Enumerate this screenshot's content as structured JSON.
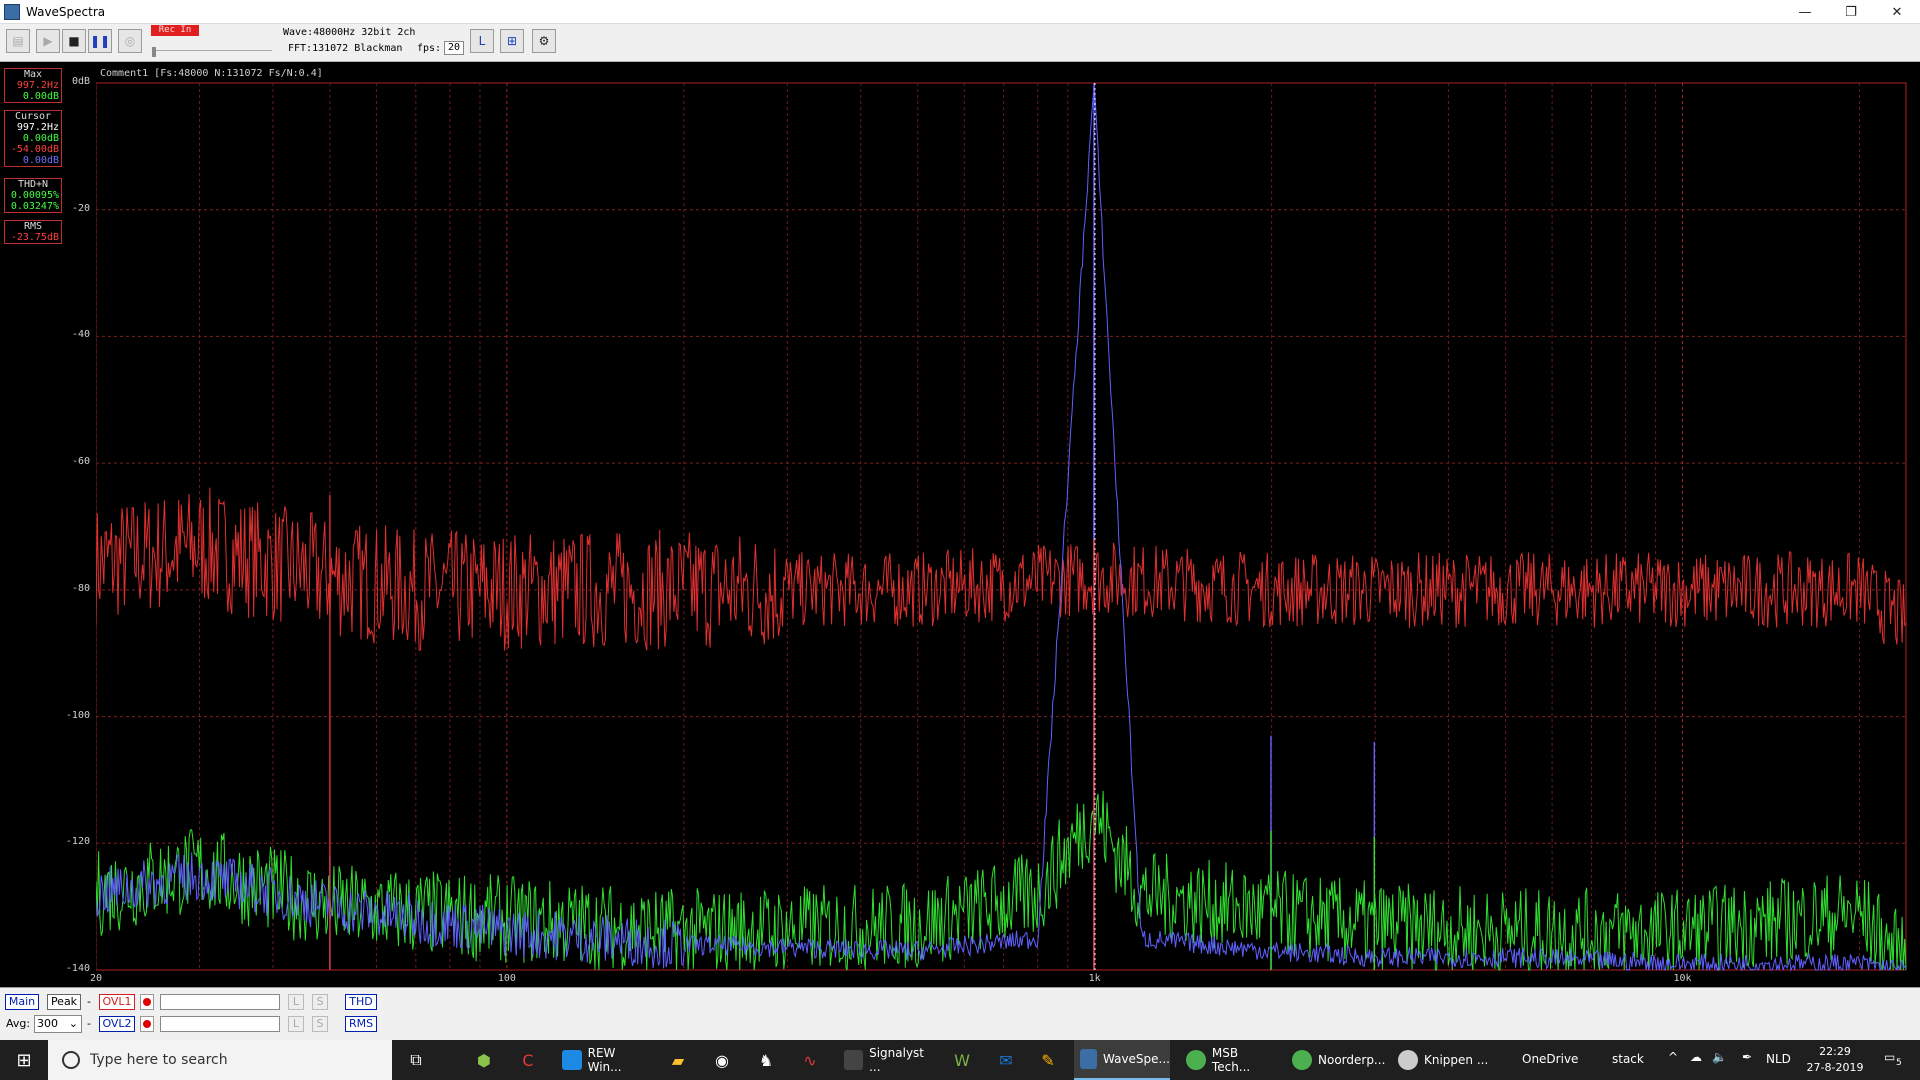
{
  "window": {
    "title": "WaveSpectra",
    "minimize": "—",
    "restore": "❐",
    "close": "✕"
  },
  "toolbar": {
    "rec_label": "Rec In",
    "wave": "Wave:48000Hz 32bit 2ch",
    "fft": "FFT:131072 Blackman",
    "fps_label": "fps:",
    "fps_value": "20"
  },
  "readouts": {
    "max": {
      "label": "Max",
      "freq": "997.2Hz",
      "level": "0.00dB"
    },
    "cursor": {
      "label": "Cursor",
      "freq": "997.2Hz",
      "level1": "0.00dB",
      "level2": "-54.00dB",
      "level3": "0.00dB"
    },
    "thdn": {
      "label": "THD+N",
      "value1": "0.00095%",
      "value2": "0.03247%"
    },
    "rms": {
      "label": "RMS",
      "value": "-23.75dB"
    }
  },
  "plot": {
    "comment": "Comment1  [Fs:48000 N:131072 Fs/N:0.4]",
    "y_labels": [
      "0dB",
      "-20",
      "-40",
      "-60",
      "-80",
      "-100",
      "-120",
      "-140"
    ],
    "x_labels": [
      "20",
      "100",
      "1k",
      "10k"
    ]
  },
  "chart_data": {
    "type": "line",
    "title": "",
    "xlabel": "",
    "ylabel": "",
    "x_scale": "log",
    "xlim": [
      20,
      24000
    ],
    "ylim": [
      -140,
      0
    ],
    "grid": true,
    "series": [
      {
        "color": "#e03030",
        "x": [
          20,
          30,
          50,
          70,
          100,
          200,
          500,
          997,
          2000,
          5000,
          10000,
          20000,
          24000
        ],
        "y": [
          -76,
          -73,
          -78,
          -80,
          -80,
          -80,
          -80,
          -78,
          -80,
          -80,
          -80,
          -80,
          -85
        ]
      },
      {
        "color": "#30e030",
        "x": [
          20,
          30,
          50,
          100,
          200,
          500,
          800,
          997,
          1200,
          2000,
          3000,
          5000,
          10000,
          20000,
          24000
        ],
        "y": [
          -128,
          -124,
          -130,
          -132,
          -134,
          -133,
          -128,
          -115,
          -128,
          -131,
          -133,
          -134,
          -134,
          -131,
          -139
        ]
      },
      {
        "color": "#6060ff",
        "x": [
          20,
          30,
          50,
          100,
          200,
          500,
          800,
          997,
          1200,
          2000,
          3000,
          5000,
          10000,
          20000,
          24000
        ],
        "y": [
          -128,
          -125,
          -130,
          -134,
          -136,
          -137,
          -135,
          0,
          -135,
          -137,
          -138,
          -138,
          -139,
          -139,
          -140
        ]
      }
    ],
    "peaks": [
      {
        "x": 997,
        "y": 0,
        "color": "#6060ff"
      },
      {
        "x": 997,
        "y": -32,
        "color": "#6060ff"
      },
      {
        "x": 997,
        "y": -72,
        "color": "#e03030"
      },
      {
        "x": 1995,
        "y": -103,
        "color": "#6060ff"
      },
      {
        "x": 1995,
        "y": -118,
        "color": "#30e030"
      },
      {
        "x": 2990,
        "y": -104,
        "color": "#6060ff"
      },
      {
        "x": 2990,
        "y": -119,
        "color": "#30e030"
      },
      {
        "x": 50,
        "y": -122,
        "color": "#6060ff"
      },
      {
        "x": 50,
        "y": -65,
        "color": "#e03030"
      }
    ]
  },
  "bottom": {
    "main": "Main",
    "peak": "Peak",
    "dash": "-",
    "ovl1": "OVL1",
    "ovl2": "OVL2",
    "l": "L",
    "s": "S",
    "thd": "THD",
    "rms": "RMS",
    "avg_label": "Avg:",
    "avg_value": "300"
  },
  "taskbar": {
    "search_placeholder": "Type here to search",
    "tasks": [
      "REW Win...",
      "Signalyst ...",
      "WaveSpe...",
      "MSB Tech...",
      "Noorderp...",
      "Knippen ..."
    ],
    "onedrive": "OneDrive",
    "stack": "stack",
    "lang": "NLD",
    "time": "22:29",
    "date": "27-8-2019",
    "notif": "5"
  }
}
